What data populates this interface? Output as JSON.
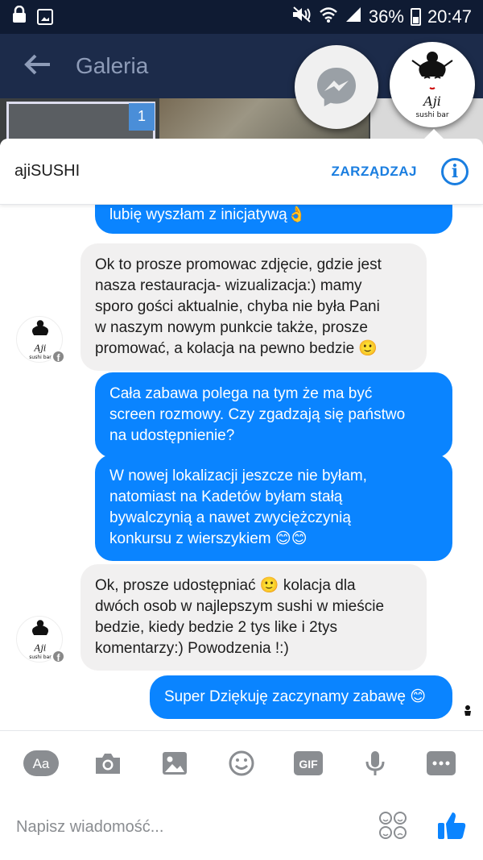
{
  "status_bar": {
    "battery": "36%",
    "time": "20:47"
  },
  "background_app": {
    "title": "Galeria",
    "badge": "1"
  },
  "chat": {
    "name": "ajiSUSHI",
    "manage_label": "ZARZĄDZAJ",
    "info_label": "i",
    "messages": [
      {
        "from": "me",
        "lines": [
          "lubię wyszłam z inicjatywą👌"
        ]
      },
      {
        "from": "them",
        "lines": [
          "Ok to prosze promowac zdjęcie, gdzie jest",
          "nasza restauracja- wizualizacja:) mamy",
          "sporo gości aktualnie, chyba nie była Pani",
          "w naszym nowym punkcie także, prosze",
          "promować, a kolacja na pewno bedzie 🙂"
        ]
      },
      {
        "from": "me",
        "lines": [
          "Cała zabawa polega na tym że ma być",
          "screen rozmowy. Czy zgadzają się państwo",
          "na udostępnienie?"
        ]
      },
      {
        "from": "me",
        "lines": [
          "W nowej lokalizacji jeszcze nie byłam,",
          "natomiast na Kadetów byłam stałą",
          "bywalczynią a nawet zwyciężczynią",
          "konkursu z wierszykiem 😊😊"
        ]
      },
      {
        "from": "them",
        "lines": [
          "Ok, prosze udostępniać 🙂 kolacja dla",
          "dwóch osob w najlepszym sushi w mieście",
          "bedzie, kiedy bedzie 2 tys like i 2tys",
          "komentarzy:) Powodzenia !:)"
        ]
      },
      {
        "from": "me",
        "lines": [
          "Super Dziękuję zaczynamy zabawę 😊"
        ]
      }
    ]
  },
  "toolbar": {
    "text_label": "Aa",
    "gif_label": "GIF"
  },
  "composer": {
    "placeholder": "Napisz wiadomość..."
  },
  "colors": {
    "accent": "#0a84ff",
    "manage": "#1a7ee0",
    "incoming_bg": "#f1f0f0"
  },
  "icons": [
    "text-icon",
    "camera-icon",
    "image-icon",
    "emoji-icon",
    "gif-icon",
    "mic-icon",
    "more-icon",
    "stickers-icon",
    "like-icon"
  ]
}
